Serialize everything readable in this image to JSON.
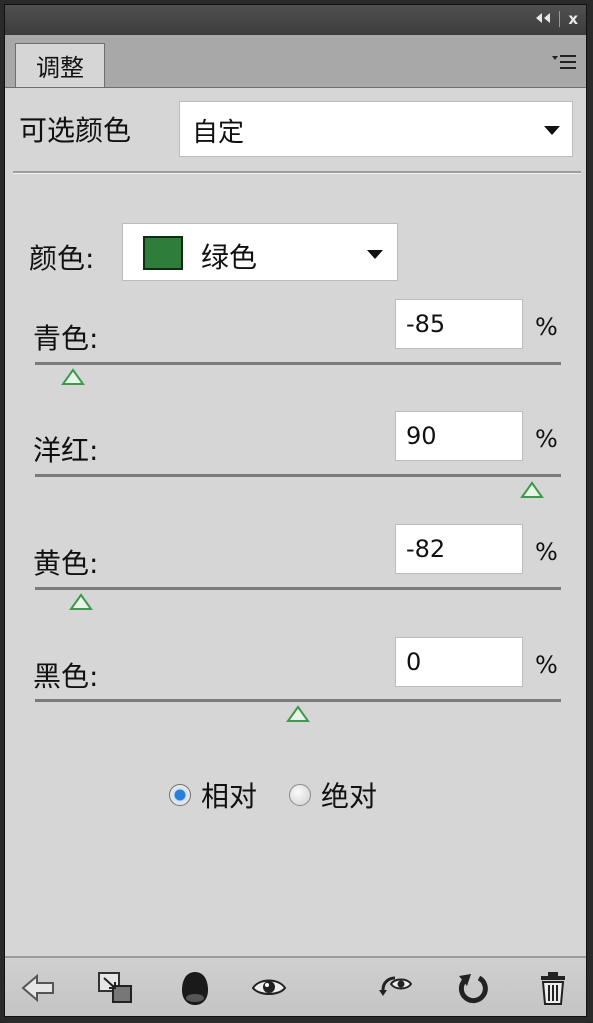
{
  "titlebar": {
    "collapse_icon": "double-left-arrow-icon",
    "close_label": "x"
  },
  "tab": {
    "label": "调整"
  },
  "preset": {
    "label": "可选颜色",
    "value": "自定"
  },
  "color": {
    "label": "颜色:",
    "value": "绿色",
    "swatch_color": "#2e7d3a"
  },
  "sliders": [
    {
      "label": "青色:",
      "value": "-85",
      "unit": "%",
      "level": -85
    },
    {
      "label": "洋红:",
      "value": "90",
      "unit": "%",
      "level": 90
    },
    {
      "label": "黄色:",
      "value": "-82",
      "unit": "%",
      "level": -82
    },
    {
      "label": "黑色:",
      "value": "0",
      "unit": "%",
      "level": 0
    }
  ],
  "method": {
    "options": [
      "相对",
      "绝对"
    ],
    "selected": "相对"
  },
  "bottom_icons": [
    "back-arrow-icon",
    "clip-to-layer-icon",
    "visibility-mask-icon",
    "eye-icon",
    "view-previous-icon",
    "reset-icon",
    "trash-icon"
  ],
  "colors": {
    "panel_bg": "#d6d6d6",
    "titlebar_bg": "#454545",
    "thumb_green": "#3d9a4a",
    "radio_blue": "#2a7fd8"
  }
}
